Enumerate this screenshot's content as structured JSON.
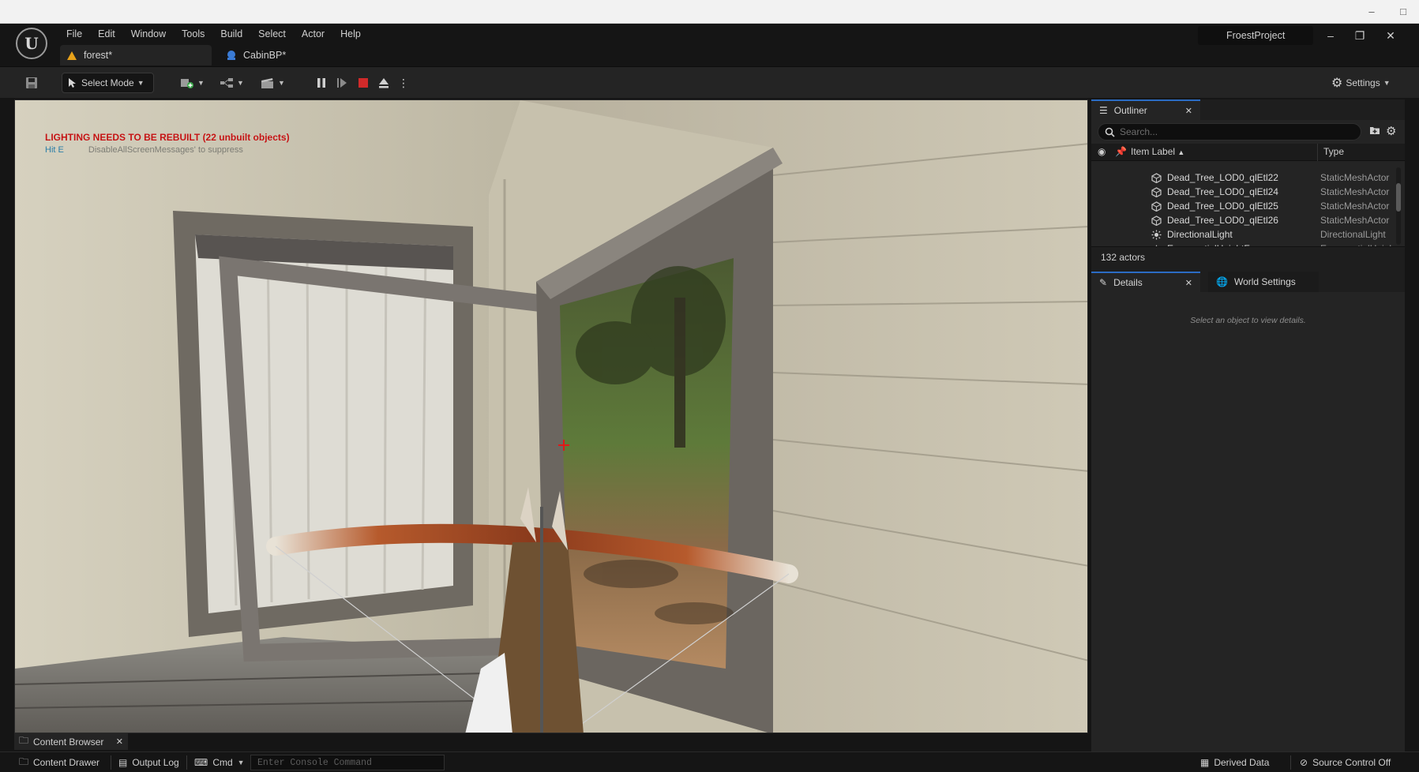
{
  "app": {
    "menu": [
      "File",
      "Edit",
      "Window",
      "Tools",
      "Build",
      "Select",
      "Actor",
      "Help"
    ],
    "tabs": [
      {
        "label": "forest*",
        "icon": "level-icon"
      },
      {
        "label": "CabinBP*",
        "icon": "blueprint-icon"
      }
    ],
    "project_name": "FroestProject",
    "window_controls": [
      "minimize",
      "restore",
      "close"
    ]
  },
  "toolbar": {
    "select_mode_label": "Select Mode",
    "settings_label": "Settings"
  },
  "viewport": {
    "warning_text": "LIGHTING NEEDS TO BE REBUILT (22 unbuilt objects)",
    "hint_key": "Hit E",
    "hint_text": "DisableAllScreenMessages' to suppress"
  },
  "outliner": {
    "tab_label": "Outliner",
    "search_placeholder": "Search...",
    "col_label": "Item Label",
    "col_type": "Type",
    "rows": [
      {
        "label": "Dead_Tree_LOD0_qlEtl22",
        "type": "StaticMeshActor",
        "icon": "static-mesh-icon"
      },
      {
        "label": "Dead_Tree_LOD0_qlEtl24",
        "type": "StaticMeshActor",
        "icon": "static-mesh-icon"
      },
      {
        "label": "Dead_Tree_LOD0_qlEtl25",
        "type": "StaticMeshActor",
        "icon": "static-mesh-icon"
      },
      {
        "label": "Dead_Tree_LOD0_qlEtl26",
        "type": "StaticMeshActor",
        "icon": "static-mesh-icon"
      },
      {
        "label": "DirectionalLight",
        "type": "DirectionalLight",
        "icon": "directional-light-icon"
      },
      {
        "label": "ExponentialHeightFog",
        "type": "ExponentialHeigh",
        "icon": "fog-icon"
      }
    ],
    "actor_count": "132 actors"
  },
  "details": {
    "tab_label": "Details",
    "world_settings_label": "World Settings",
    "empty_message": "Select an object to view details."
  },
  "bottom": {
    "content_browser_label": "Content Browser",
    "content_drawer_label": "Content Drawer",
    "output_log_label": "Output Log",
    "cmd_label": "Cmd",
    "console_placeholder": "Enter Console Command",
    "derived_data_label": "Derived Data",
    "source_control_label": "Source Control Off"
  },
  "colors": {
    "accent": "#2b6cc4",
    "warning": "#c41212",
    "stop": "#d02a2a"
  }
}
